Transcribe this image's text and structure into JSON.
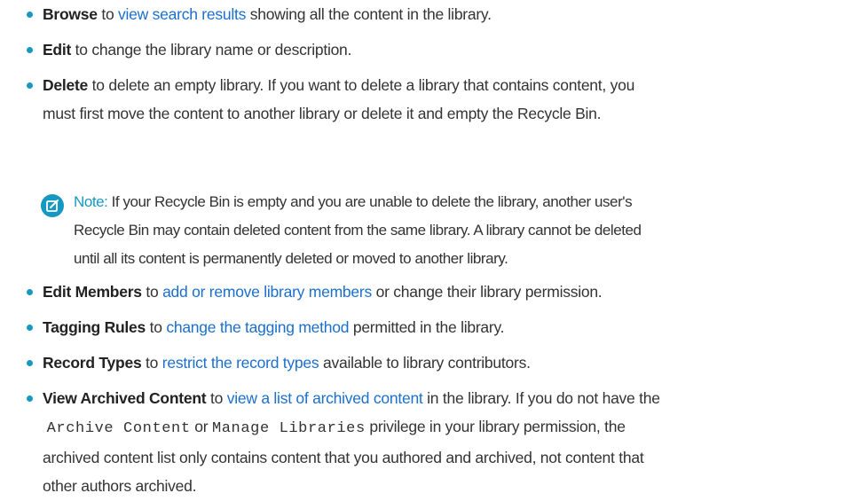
{
  "items": {
    "browse": {
      "bold": "Browse",
      "pre": " to ",
      "link": "view search results",
      "post": " showing all the content in the library."
    },
    "edit": {
      "bold": "Edit",
      "post": " to change the library name or description."
    },
    "delete": {
      "bold": "Delete",
      "line1": " to delete an empty library. If you want to delete a library that contains content, you",
      "line2": "must first move the content to another library or delete it and empty the Recycle Bin."
    },
    "edit_members": {
      "bold": "Edit Members",
      "pre": " to ",
      "link": "add or remove library members",
      "post": " or change their library permission."
    },
    "tagging_rules": {
      "bold": "Tagging Rules",
      "pre": " to ",
      "link": "change the tagging method",
      "post": " permitted in the library."
    },
    "record_types": {
      "bold": "Record Types",
      "pre": " to ",
      "link": "restrict the record types",
      "post": " available to library contributors."
    },
    "view_archived": {
      "bold": "View Archived Content",
      "pre": " to ",
      "link": "view a list of archived content",
      "post1": " in the library. If you do not have the",
      "code1": "Archive Content",
      "mid": " or ",
      "code2": "Manage Libraries",
      "post2": " privilege in your library permission, the",
      "line3": "archived content list only contains content that you authored and archived, not content that",
      "line4": "other authors archived."
    }
  },
  "note": {
    "label": "Note:",
    "line1": " If your Recycle Bin is empty and you are unable to delete the library, another user's",
    "line2": "Recycle Bin may contain deleted content from the same library. A library cannot be deleted",
    "line3": "until all its content is permanently deleted or moved to another library.",
    "icon": "edit-note-icon"
  },
  "colors": {
    "bullet": "#1798c1",
    "link": "#1b6fce",
    "note": "#1798c1"
  }
}
